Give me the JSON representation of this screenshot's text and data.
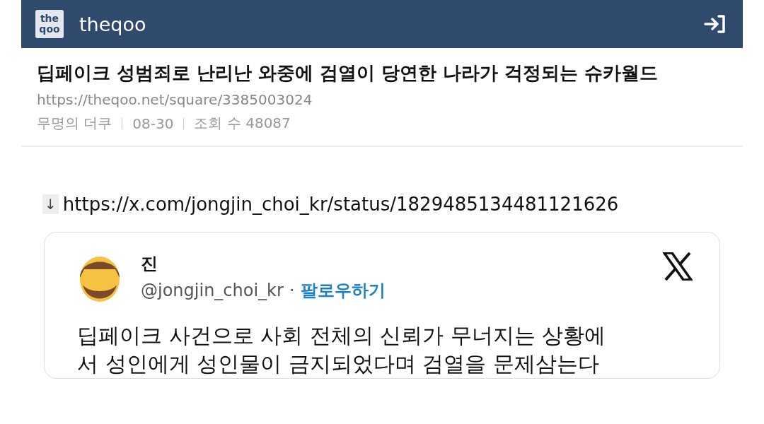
{
  "header": {
    "site_name": "theqoo",
    "logo_text": [
      "the",
      "qoo"
    ]
  },
  "post": {
    "title": "딥페이크 성범죄로 난리난 와중에 검열이 당연한 나라가 걱정되는 슈카월드",
    "url": "https://theqoo.net/square/3385003024",
    "meta": [
      "무명의 더쿠",
      "08-30",
      "조회 수 48087"
    ]
  },
  "link": {
    "marker": "↓",
    "url": "https://x.com/jongjin_choi_kr/status/1829485134481121626"
  },
  "tweet": {
    "name": "진",
    "handle": "@jongjin_choi_kr",
    "separator": "·",
    "follow": "팔로우하기",
    "lines": [
      "딥페이크 사건으로 사회 전체의 신뢰가 무너지는 상황에",
      "서 성인에게 성인물이 금지되었다며 검열을 문제삼는다"
    ]
  }
}
